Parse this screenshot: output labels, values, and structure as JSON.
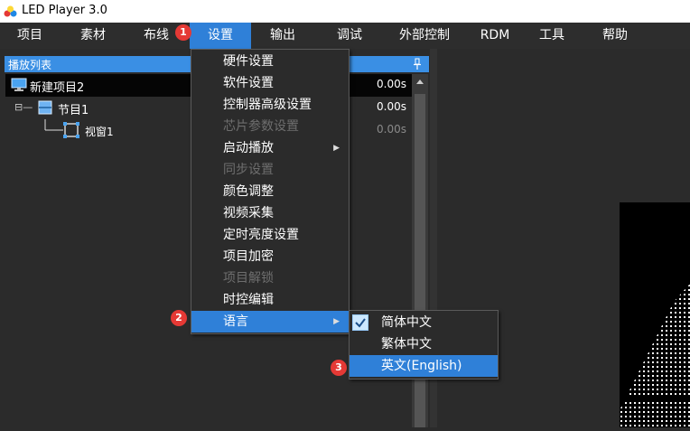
{
  "window": {
    "title": "LED Player 3.0"
  },
  "menubar": {
    "items": [
      {
        "label": "项目"
      },
      {
        "label": "素材"
      },
      {
        "label": "布线"
      },
      {
        "label": "设置"
      },
      {
        "label": "输出"
      },
      {
        "label": "调试"
      },
      {
        "label": "外部控制"
      },
      {
        "label": "RDM"
      },
      {
        "label": "工具"
      },
      {
        "label": "帮助"
      }
    ]
  },
  "playlist": {
    "header": "播放列表",
    "pin_icon": "pin-icon",
    "rows": [
      {
        "label": "新建项目2",
        "time": "0.00s",
        "icon": "monitor-icon",
        "tree_prefix": ""
      },
      {
        "label": "节目1",
        "time": "0.00s",
        "icon": "program-icon",
        "tree_prefix": "⊟—"
      },
      {
        "label": "视窗1",
        "time": "0.00s",
        "icon": "window-icon",
        "tree_prefix": ""
      }
    ]
  },
  "settings_menu": {
    "items": [
      {
        "label": "硬件设置",
        "enabled": true
      },
      {
        "label": "软件设置",
        "enabled": true
      },
      {
        "label": "控制器高级设置",
        "enabled": true
      },
      {
        "label": "芯片参数设置",
        "enabled": false
      },
      {
        "label": "启动播放",
        "enabled": true,
        "submenu": true
      },
      {
        "label": "同步设置",
        "enabled": false
      },
      {
        "label": "颜色调整",
        "enabled": true
      },
      {
        "label": "视频采集",
        "enabled": true
      },
      {
        "label": "定时亮度设置",
        "enabled": true
      },
      {
        "label": "项目加密",
        "enabled": true
      },
      {
        "label": "项目解锁",
        "enabled": false
      },
      {
        "label": "时控编辑",
        "enabled": true
      },
      {
        "label": "语言",
        "enabled": true,
        "submenu": true,
        "highlighted": true
      }
    ]
  },
  "language_menu": {
    "items": [
      {
        "label": "简体中文",
        "checked": true
      },
      {
        "label": "繁体中文",
        "checked": false
      },
      {
        "label": "英文(English)",
        "checked": false,
        "highlighted": true
      }
    ]
  },
  "badges": [
    "1",
    "2",
    "3"
  ],
  "colors": {
    "accent": "#2f80d8",
    "panel_header": "#3a8fe4",
    "badge": "#e53935",
    "background": "#2b2b2b"
  }
}
